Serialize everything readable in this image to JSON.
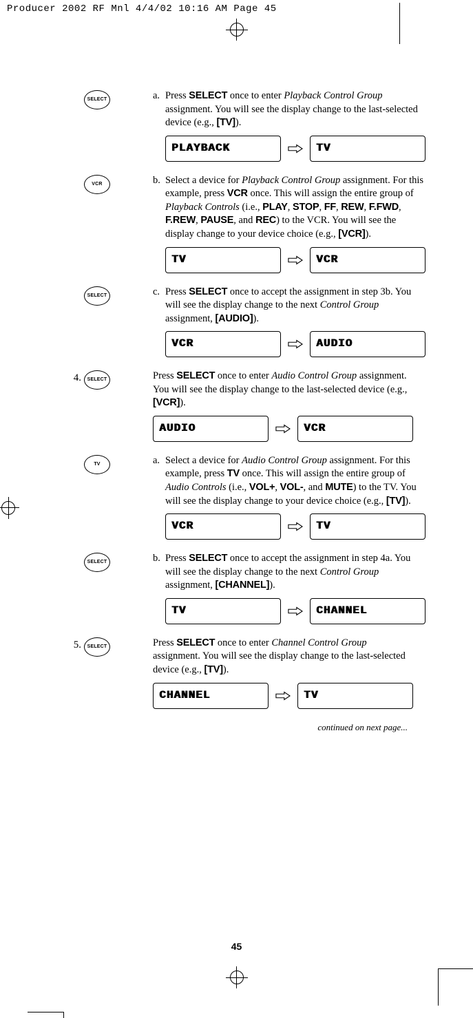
{
  "print_header": "Producer 2002 RF Mnl  4/4/02  10:16 AM  Page 45",
  "page_number": "45",
  "continued": "continued on next page...",
  "buttons": {
    "select": "SELECT",
    "vcr": "VCR",
    "tv": "TV"
  },
  "steps": [
    {
      "num": "",
      "icon": "select",
      "letter": "a.",
      "html": "Press <b class='cond'>SELECT</b> once to enter <i>Playback Control Group</i> assignment. You will see the display change to the last-selected device (e.g., <b class='cond'>[TV]</b>).",
      "lcd_from": "PLAYBACK",
      "lcd_to": "TV"
    },
    {
      "num": "",
      "icon": "vcr",
      "letter": "b.",
      "html": "Select a device for <i>Playback Control Group</i> assignment. For this example, press <b class='cond'>VCR</b> once. This will assign the entire group of <i>Playback Controls</i> (i.e., <b class='cond'>PLAY</b>, <b class='cond'>STOP</b>, <b class='cond'>FF</b>, <b class='cond'>REW</b>, <b class='cond'>F.FWD</b>, <b class='cond'>F.REW</b>, <b class='cond'>PAUSE</b>, and <b class='cond'>REC</b>) to the VCR. You will see the display change to your device choice (e.g., <b class='cond'>[VCR]</b>).",
      "lcd_from": "TV",
      "lcd_to": "VCR"
    },
    {
      "num": "",
      "icon": "select",
      "letter": "c.",
      "html": "Press <b class='cond'>SELECT</b> once to accept the assignment in step 3b. You will see the display change to the next <i>Control Group</i> assignment, <b class='cond'>[AUDIO]</b>).",
      "lcd_from": "VCR",
      "lcd_to": "AUDIO"
    },
    {
      "num": "4.",
      "icon": "select",
      "letter": "",
      "html": "Press <b class='cond'>SELECT</b> once to enter <i>Audio Control Group</i> assignment. You will see the display change to the last-selected device (e.g., <b class='cond'>[VCR]</b>).",
      "lcd_from": "AUDIO",
      "lcd_to": "VCR"
    },
    {
      "num": "",
      "icon": "tv",
      "letter": "a.",
      "html": "Select a device for <i>Audio Control Group</i> assignment. For this example, press <b class='cond'>TV</b> once. This will assign the entire group of <i>Audio Controls</i> (i.e., <b class='cond'>VOL+</b>, <b class='cond'>VOL-</b>, and <b class='cond'>MUTE</b>) to the TV. You will see the display change to your device choice (e.g., <b class='cond'>[TV]</b>).",
      "lcd_from": "VCR",
      "lcd_to": "TV"
    },
    {
      "num": "",
      "icon": "select",
      "letter": "b.",
      "html": "Press <b class='cond'>SELECT</b> once to accept the assignment in step 4a. You will see the display change to the next <i>Control Group</i> assignment, <b class='cond'>[CHANNEL]</b>).",
      "lcd_from": "TV",
      "lcd_to": "CHANNEL"
    },
    {
      "num": "5.",
      "icon": "select",
      "letter": "",
      "html": "Press <b class='cond'>SELECT</b> once to enter <i>Channel Control Group</i> assignment. You will see the display change to the last-selected device (e.g., <b class='cond'>[TV]</b>).",
      "lcd_from": "CHANNEL",
      "lcd_to": "TV"
    }
  ]
}
